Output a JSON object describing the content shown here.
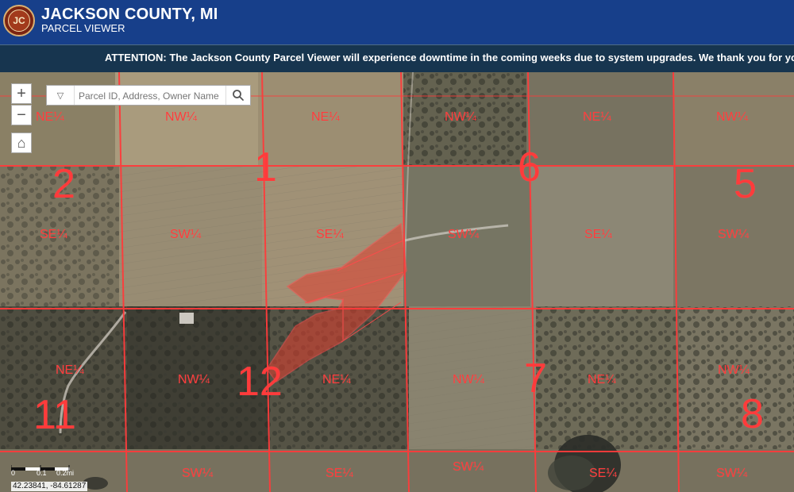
{
  "app": {
    "title": "JACKSON COUNTY, MI",
    "subtitle": "PARCEL VIEWER",
    "logo_text": "JC",
    "colors": {
      "header": "#173f8a",
      "banner": "#17354f",
      "parcel": "#ff3b3b"
    }
  },
  "banner": {
    "text": "ATTENTION: The Jackson County Parcel Viewer will experience downtime in the coming weeks due to system upgrades. We thank you for your p"
  },
  "controls": {
    "zoom_in": "+",
    "zoom_out": "−",
    "home": "⌂",
    "dropdown": "▽",
    "search_icon": "magnifier-icon"
  },
  "search": {
    "placeholder": "Parcel ID, Address, Owner Name"
  },
  "map": {
    "sections": [
      "1",
      "2",
      "5",
      "6",
      "7",
      "8",
      "11",
      "12"
    ],
    "quarter_labels": [
      "NE¼",
      "NW¼",
      "SE¼",
      "SW¼"
    ],
    "scale": {
      "left": "0",
      "middle": "0.1",
      "right": "0.2mi"
    },
    "coordinates": "42.23841, -84.61287"
  }
}
